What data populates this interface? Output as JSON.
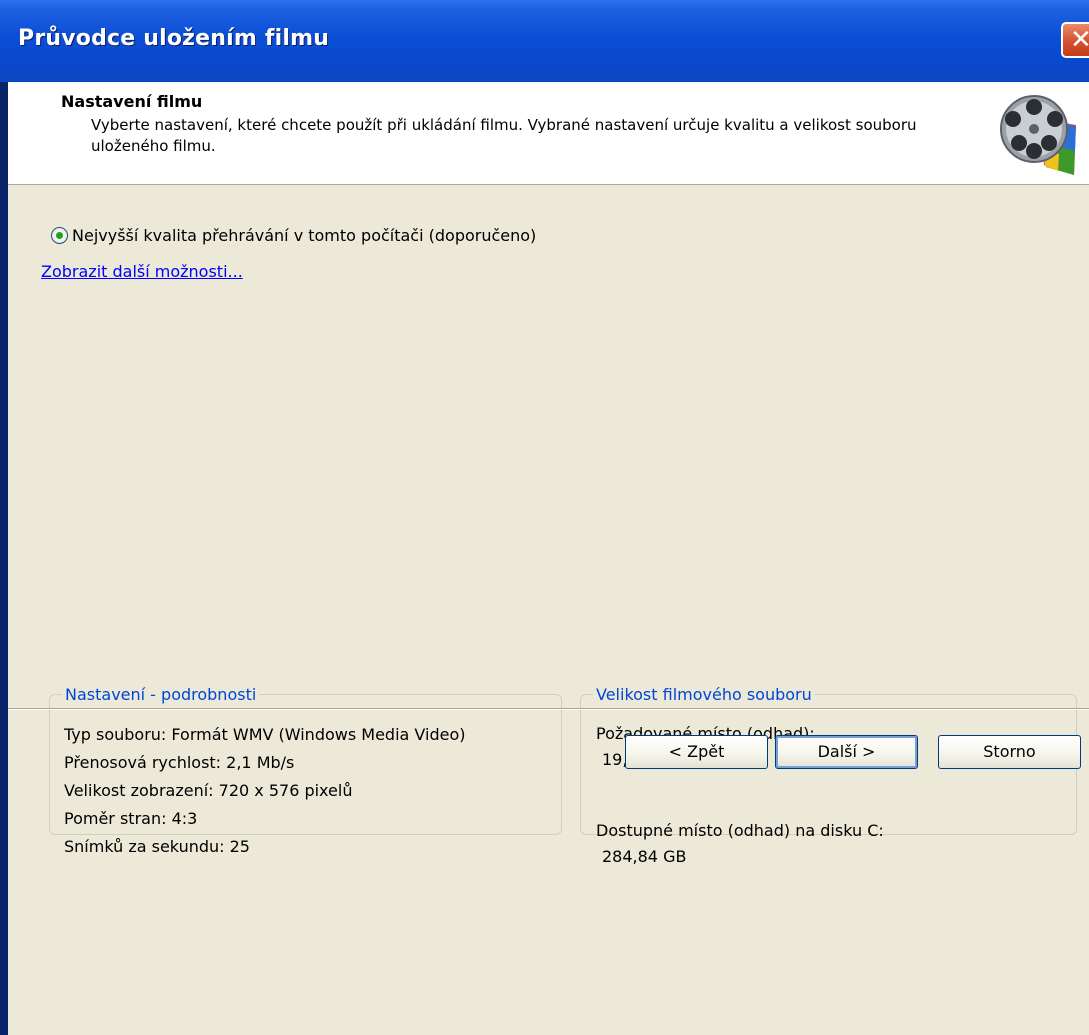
{
  "window": {
    "title": "Průvodce uložením filmu"
  },
  "header": {
    "title": "Nastavení filmu",
    "description": "Vyberte nastavení, které chcete použít při ukládání filmu. Vybrané nastavení určuje kvalitu a velikost souboru uloženého filmu."
  },
  "options": {
    "radio_label": "Nejvyšší kvalita přehrávání v tomto počítači (doporučeno)",
    "radio_checked": true,
    "more_link": "Zobrazit další možnosti..."
  },
  "details": {
    "title": "Nastavení - podrobnosti",
    "lines": [
      "Typ souboru: Formát WMV (Windows Media Video)",
      "Přenosová rychlost: 2,1 Mb/s",
      "Velikost zobrazení: 720 x 576 pixelů",
      "Poměr stran: 4:3",
      "Snímků za sekundu: 25"
    ]
  },
  "size": {
    "title": "Velikost filmového souboru",
    "required_label": "Požadované místo (odhad):",
    "required_value": "19,87 MB",
    "available_label": "Dostupné místo (odhad) na disku C:",
    "available_value": "284,84 GB"
  },
  "buttons": {
    "back": "< Zpět",
    "next": "Další >",
    "cancel": "Storno"
  },
  "icons": {
    "close": "close-icon",
    "header": "movie-maker-film-reel-icon"
  },
  "colors": {
    "titlebar": "#0b4fd6",
    "client": "#ece9d8",
    "legend": "#0046d5",
    "link": "#0000ff",
    "close": "#d4512f"
  }
}
